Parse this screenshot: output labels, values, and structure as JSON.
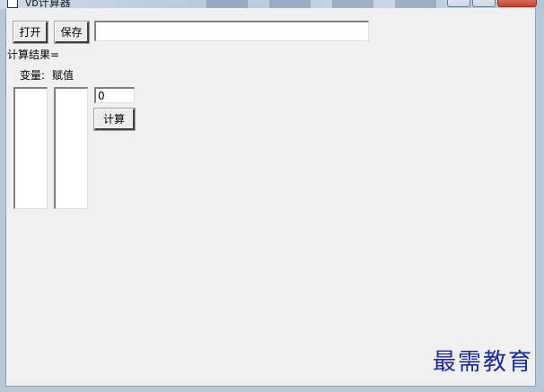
{
  "window": {
    "title": "vb计算器"
  },
  "toolbar": {
    "open_label": "打开",
    "save_label": "保存",
    "path_value": ""
  },
  "result": {
    "label": "计算结果="
  },
  "headers": {
    "variable": "变量:",
    "assign": "赋值"
  },
  "lists": {
    "variables": [],
    "values": []
  },
  "value_input": {
    "value": "0"
  },
  "calc_button": {
    "label": "计算"
  },
  "watermark": {
    "text": "最需教育"
  }
}
